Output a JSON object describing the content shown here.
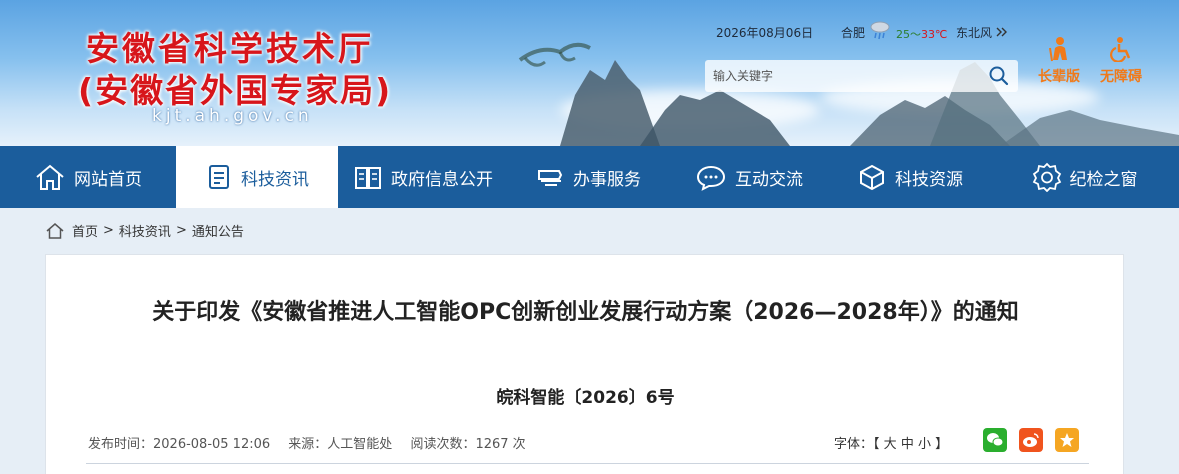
{
  "header": {
    "title_line1": "安徽省科学技术厅",
    "title_line2": "(安徽省外国专家局)",
    "domain": "kjt.ah.gov.cn",
    "date": "2026年08月06日",
    "city": "合肥",
    "temp_low": "25",
    "temp_sep": "～",
    "temp_high": "33℃",
    "wind": "东北风",
    "more_icon": "double-chevron-right",
    "search_placeholder": "输入关键字",
    "elder_label": "长辈版",
    "accessible_label": "无障碍"
  },
  "nav": {
    "items": [
      {
        "label": "网站首页",
        "icon": "home-icon"
      },
      {
        "label": "科技资讯",
        "icon": "document-icon",
        "active": true
      },
      {
        "label": "政府信息公开",
        "icon": "book-icon"
      },
      {
        "label": "办事服务",
        "icon": "service-icon"
      },
      {
        "label": "互动交流",
        "icon": "chat-icon"
      },
      {
        "label": "科技资源",
        "icon": "cube-icon"
      },
      {
        "label": "纪检之窗",
        "icon": "badge-icon"
      }
    ]
  },
  "breadcrumb": {
    "items": [
      "首页",
      "科技资讯",
      "通知公告"
    ],
    "separator": ">"
  },
  "article": {
    "title": "关于印发《安徽省推进人工智能OPC创新创业发展行动方案（2026—2028年）》的通知",
    "doc_no": "皖科智能〔2026〕6号",
    "published": "发布时间：2026-08-05 12:06",
    "source": "来源：人工智能处",
    "views": "阅读次数：1267 次",
    "font_label": "字体：",
    "font_open": "【",
    "font_large": "大",
    "font_medium": "中",
    "font_small": "小",
    "font_close": "】"
  },
  "colors": {
    "brand_red": "#d7161b",
    "nav_blue": "#1b5d9c",
    "accent_orange": "#f07a1a",
    "wechat_green": "#2aae2e",
    "weibo_orange": "#f0541e",
    "fav_orange": "#f5a623"
  }
}
